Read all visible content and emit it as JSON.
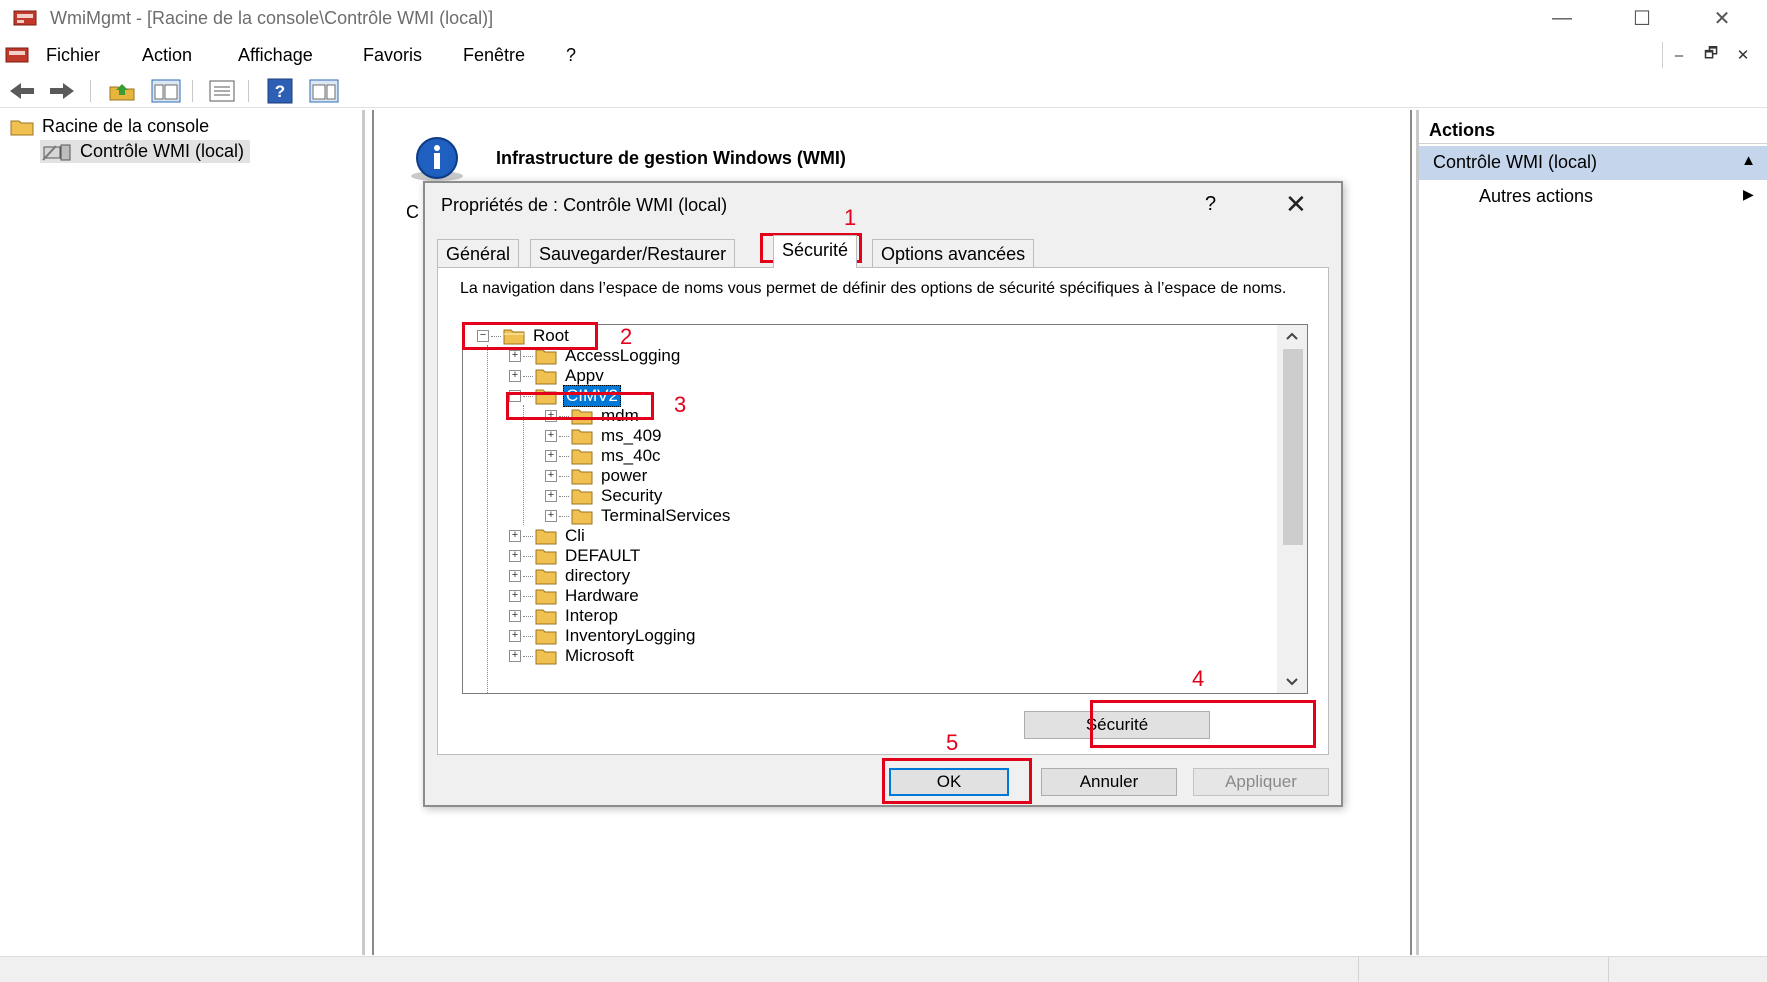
{
  "window": {
    "title": "WmiMgmt - [Racine de la console\\Contrôle WMI (local)]",
    "minimize_glyph": "—",
    "maximize_glyph": "☐",
    "close_glyph": "✕"
  },
  "menu": {
    "items": [
      "Fichier",
      "Action",
      "Affichage",
      "Favoris",
      "Fenêtre",
      "?"
    ],
    "mdi_minimize": "–",
    "mdi_restore": "🗗",
    "mdi_close": "✕"
  },
  "toolbar": {
    "icons": [
      "back-arrow-icon",
      "forward-arrow-icon",
      "up-folder-icon",
      "show-hide-tree-icon",
      "properties-icon",
      "help-icon",
      "show-hide-action-pane-icon"
    ]
  },
  "left_tree": {
    "root": "Racine de la console",
    "child": "Contrôle WMI (local)"
  },
  "center": {
    "title": "Infrastructure de gestion Windows (WMI)",
    "truncated_text": "C"
  },
  "actions": {
    "header": "Actions",
    "section": "Contrôle WMI (local)",
    "section_arrow": "▲",
    "item": "Autres actions",
    "item_arrow": "▶"
  },
  "dialog": {
    "title": "Propriétés de : Contrôle WMI (local)",
    "help": "?",
    "close": "✕",
    "tabs": [
      "Général",
      "Sauvegarder/Restaurer",
      "Sécurité",
      "Options avancées"
    ],
    "active_tab": "Sécurité",
    "description": "La navigation dans l’espace de noms vous permet de définir des options de sécurité spécifiques à l’espace de noms.",
    "namespaces": {
      "root": "Root",
      "level1_before": [
        "AccessLogging",
        "Appv"
      ],
      "selected": "CIMV2",
      "cimv2_children": [
        "mdm",
        "ms_409",
        "ms_40c",
        "power",
        "Security",
        "TerminalServices"
      ],
      "level1_after": [
        "Cli",
        "DEFAULT",
        "directory",
        "Hardware",
        "Interop",
        "InventoryLogging",
        "Microsoft"
      ]
    },
    "security_button": "Sécurité",
    "ok_button": "OK",
    "cancel_button": "Annuler",
    "apply_button": "Appliquer"
  },
  "annotations": {
    "color": "#e2001a",
    "numbers": [
      "1",
      "2",
      "3",
      "4",
      "5"
    ]
  },
  "colors": {
    "selection": "#0078d7",
    "actions_section": "#c5d6ec"
  }
}
